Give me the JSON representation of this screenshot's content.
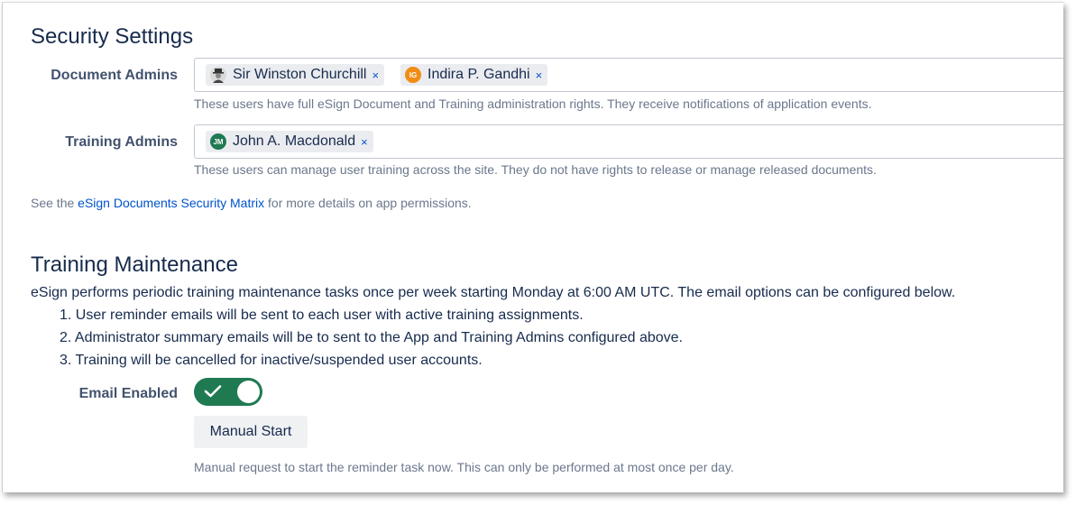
{
  "security": {
    "title": "Security Settings",
    "document_admins": {
      "label": "Document Admins",
      "users": [
        {
          "name": "Sir Winston Churchill",
          "remove": "×",
          "initials": ""
        },
        {
          "name": "Indira P. Gandhi",
          "remove": "×",
          "initials": "IG",
          "color": "#f18d13"
        }
      ],
      "help": "These users have full eSign Document and Training administration rights. They receive notifications of application events."
    },
    "training_admins": {
      "label": "Training Admins",
      "users": [
        {
          "name": "John A. Macdonald",
          "remove": "×",
          "initials": "JM",
          "color": "#1f7a52"
        }
      ],
      "help": "These users can manage user training across the site. They do not have rights to release or manage released documents."
    },
    "matrix_note": {
      "prefix": "See the ",
      "link": "eSign Documents Security Matrix",
      "suffix": " for more details on app permissions."
    }
  },
  "maintenance": {
    "title": "Training Maintenance",
    "description": "eSign performs periodic training maintenance tasks once per week starting Monday at 6:00 AM UTC. The email options can be configured below.",
    "steps": [
      "1. User reminder emails will be sent to each user with active training assignments.",
      "2. Administrator summary emails will be to sent to the App and Training Admins configured above.",
      "3. Training will be cancelled for inactive/suspended user accounts."
    ],
    "email_enabled_label": "Email Enabled",
    "email_enabled": true,
    "manual_start_label": "Manual Start",
    "manual_help": "Manual request to start the reminder task now. This can only be performed at most once per day."
  },
  "colors": {
    "accent": "#0052cc",
    "toggle_on": "#1f7a52"
  }
}
